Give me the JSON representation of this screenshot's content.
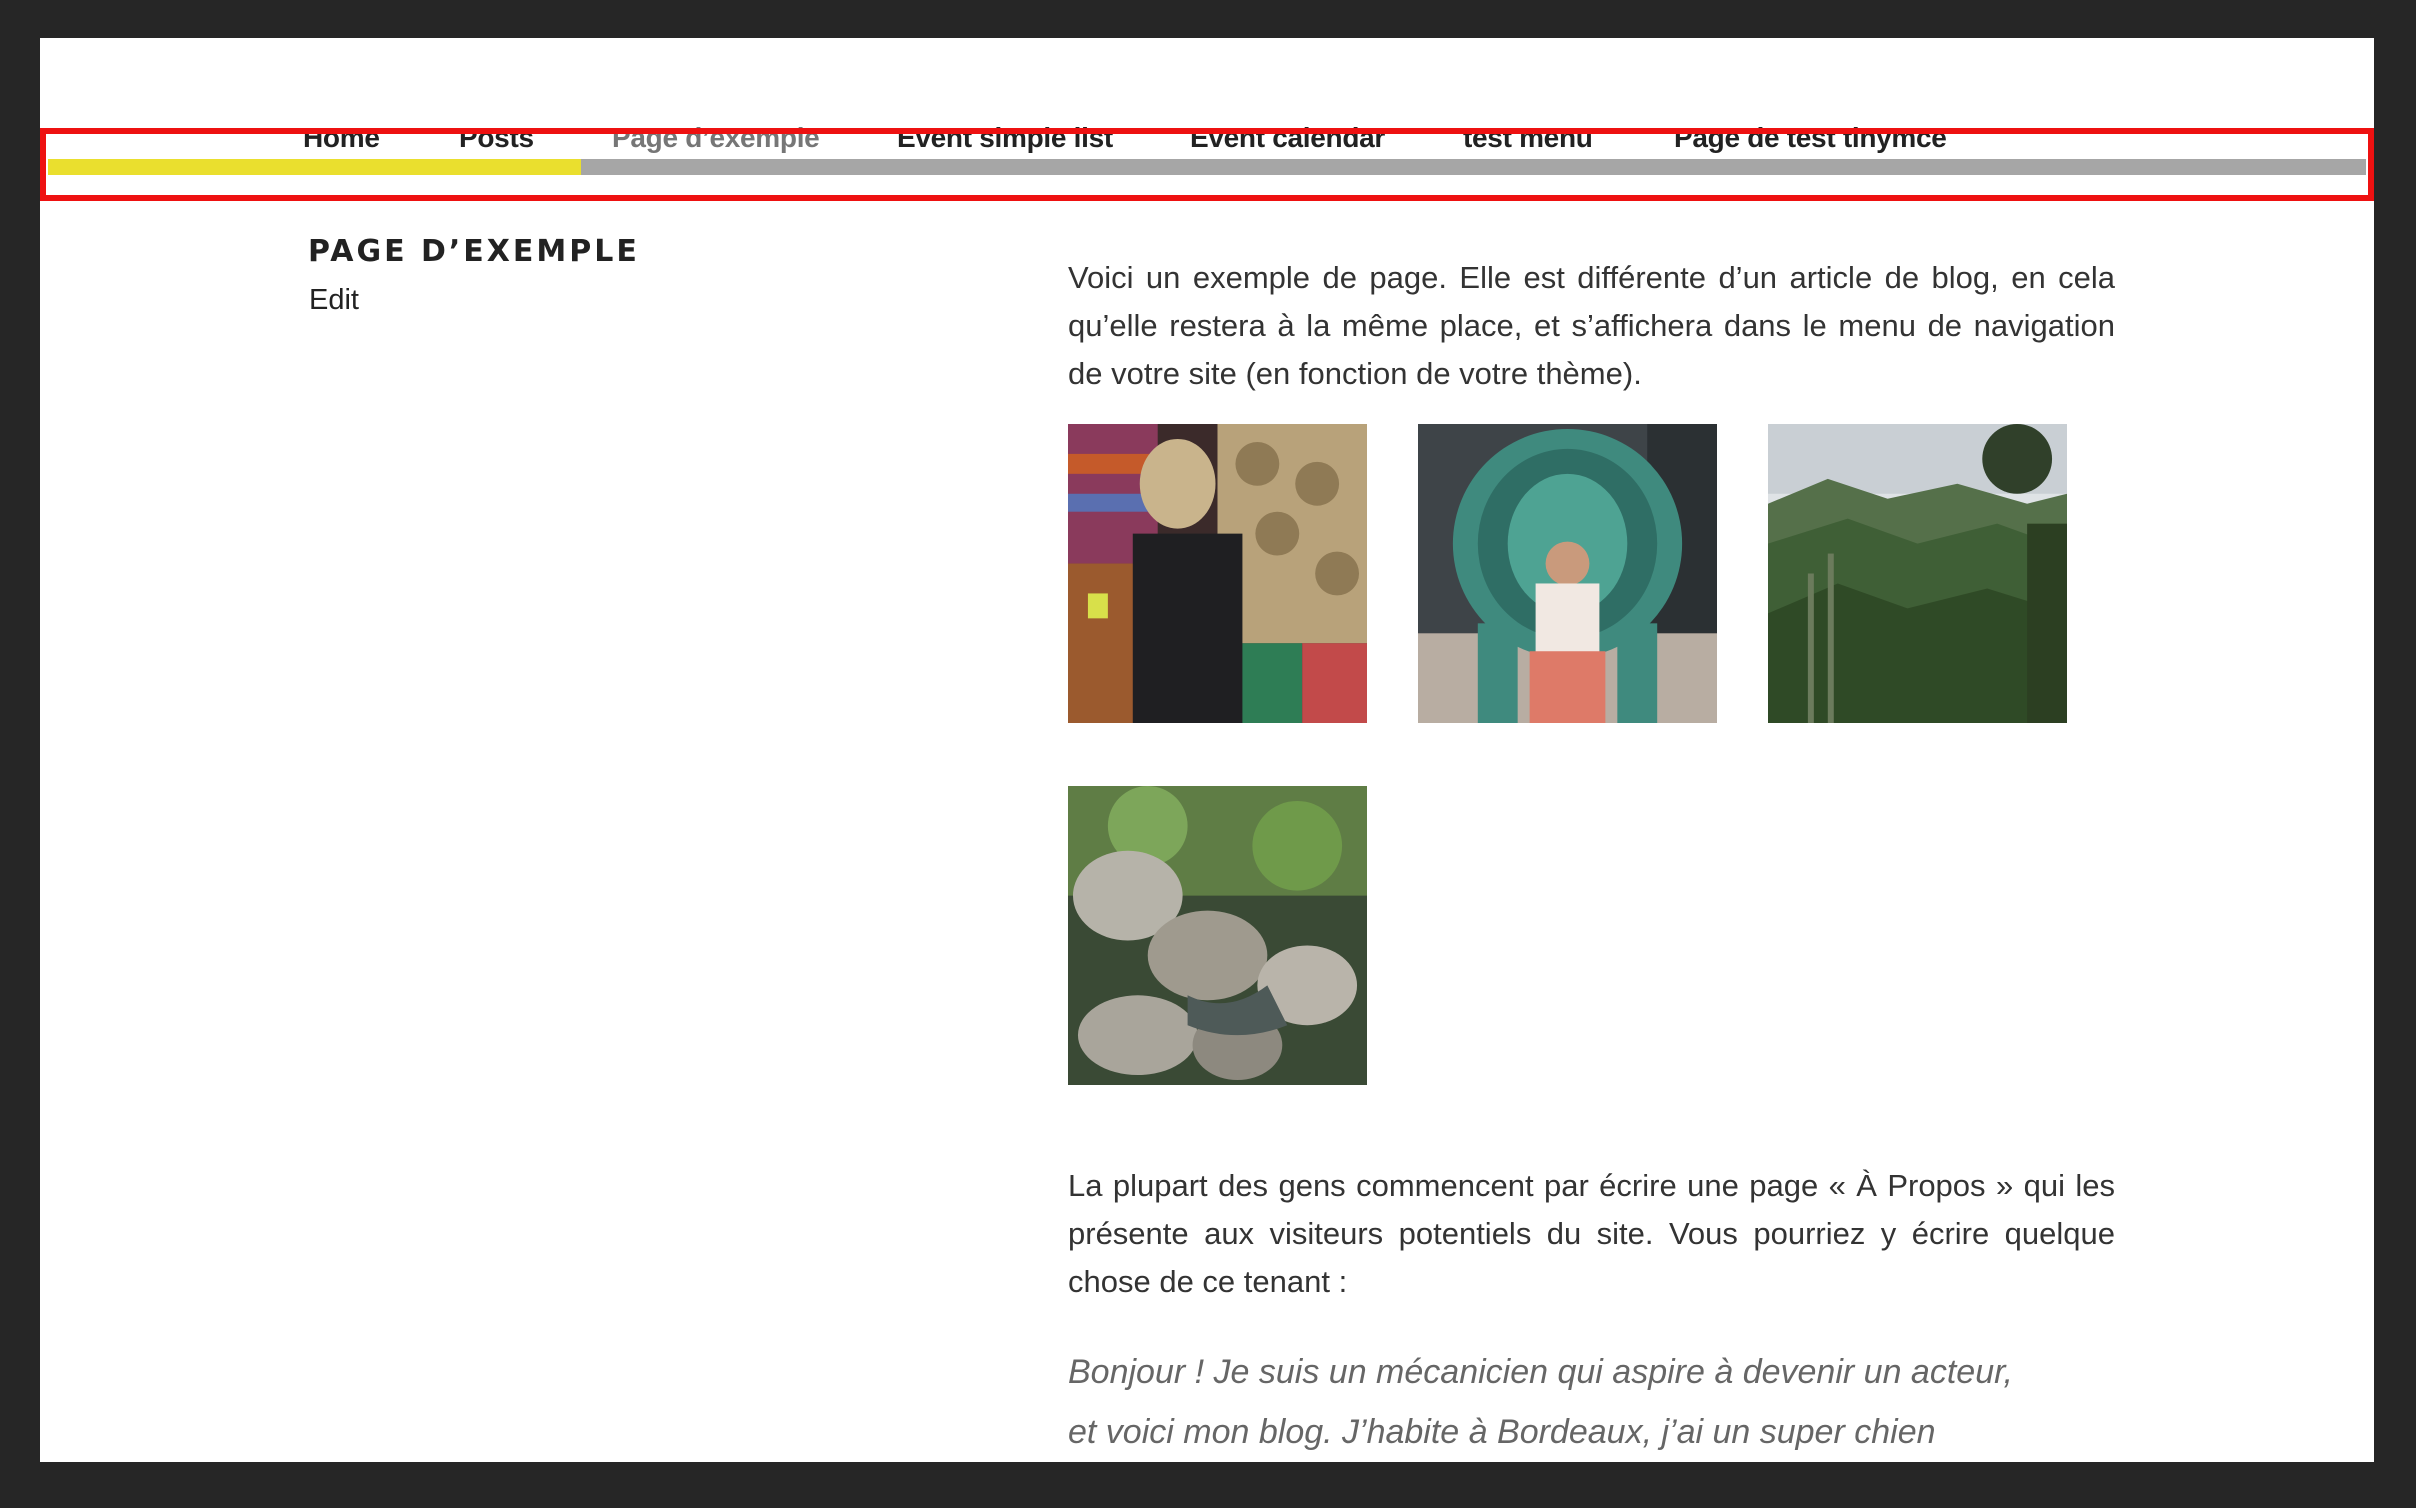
{
  "nav": {
    "items": [
      {
        "label": "Home",
        "current": false
      },
      {
        "label": "Posts",
        "current": false
      },
      {
        "label": "Page d’exemple",
        "current": true
      },
      {
        "label": "Event simple list",
        "current": false
      },
      {
        "label": "Event calendar",
        "current": false
      },
      {
        "label": "test menu",
        "current": false
      },
      {
        "label": "Page de test tinymce",
        "current": false
      }
    ]
  },
  "reading_progress": {
    "fraction": 0.23,
    "fill_color": "#eadf2e",
    "track_color": "#a6a6a6",
    "highlight_color": "#ee1111"
  },
  "header": {
    "title": "PAGE D’EXEMPLE",
    "edit_label": "Edit"
  },
  "content": {
    "intro": "Voici un exemple de page. Elle est différente d’un article de blog, en cela qu’elle restera à la même place, et s’affichera dans le menu de navigation de votre site (en fonction de votre thème).",
    "gallery": [
      {
        "icon": "market-photo"
      },
      {
        "icon": "peacock-chair-photo"
      },
      {
        "icon": "mountain-forest-photo"
      },
      {
        "icon": "river-rocks-photo"
      }
    ],
    "about_intro": "La plupart des gens commencent par écrire une page « À Propos » qui les présente aux visiteurs potentiels du site. Vous pourriez y écrire quelque chose de ce tenant :",
    "quote_line1": "Bonjour ! Je suis un mécanicien qui aspire à devenir un acteur,",
    "quote_line2": "et voici mon blog. J’habite à Bordeaux, j’ai un super chien"
  }
}
